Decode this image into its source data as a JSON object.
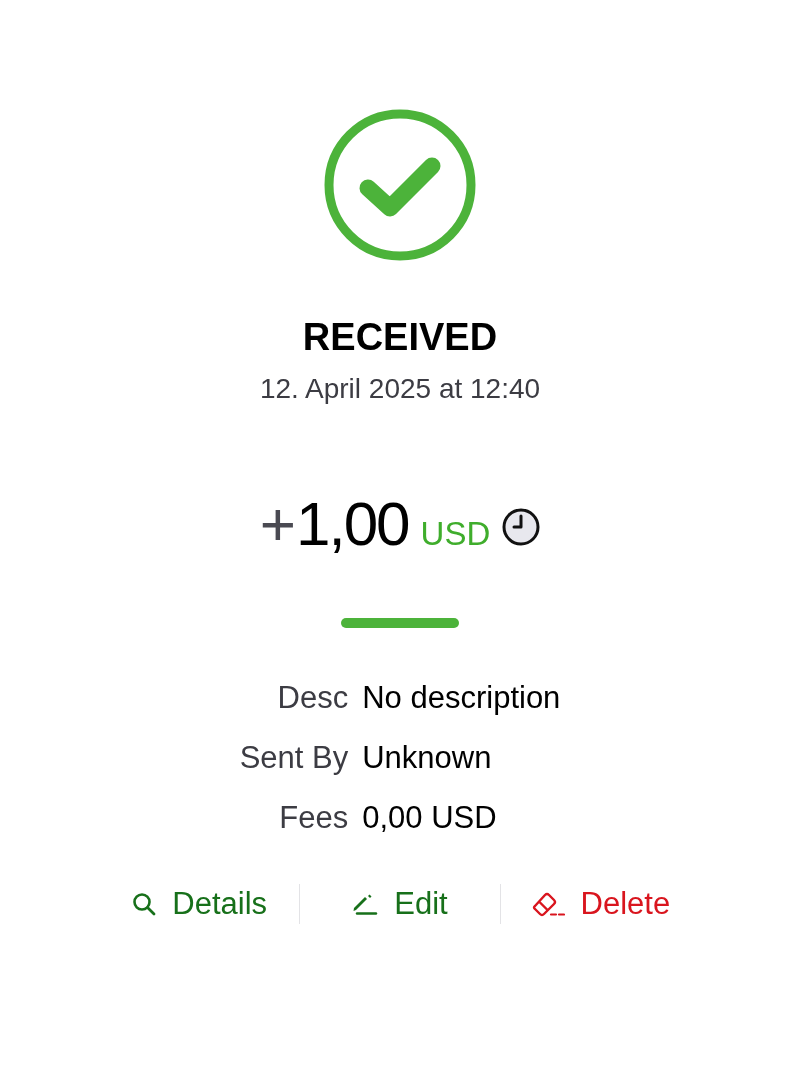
{
  "status": {
    "kind": "success",
    "title": "RECEIVED",
    "date": "12. April 2025 at 12:40"
  },
  "amount": {
    "sign": "+",
    "value": "1,00",
    "currency": "USD"
  },
  "details": [
    {
      "label": "Desc",
      "value": "No description"
    },
    {
      "label": "Sent By",
      "value": "Unknown"
    },
    {
      "label": "Fees",
      "value": "0,00 USD"
    }
  ],
  "actions": [
    {
      "kind": "details",
      "label": "Details"
    },
    {
      "kind": "edit",
      "label": "Edit"
    },
    {
      "kind": "delete",
      "label": "Delete"
    }
  ]
}
